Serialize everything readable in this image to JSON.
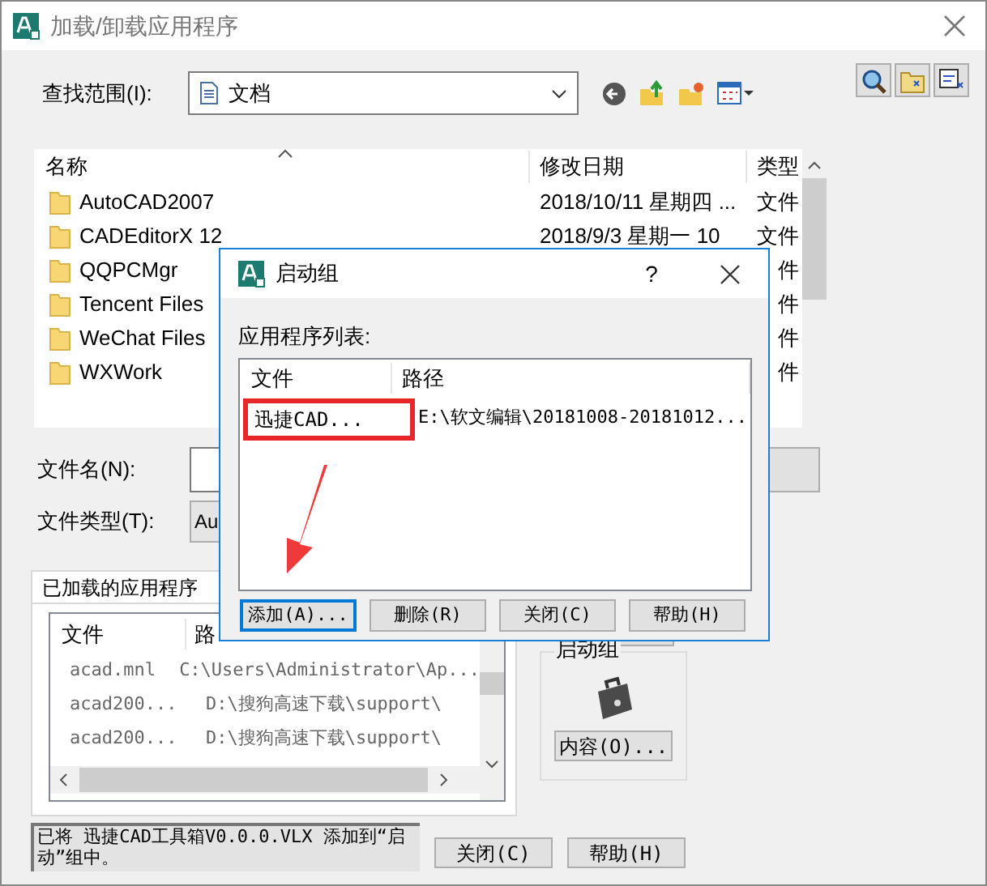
{
  "window": {
    "title": "加载/卸载应用程序"
  },
  "look_in": {
    "label": "查找范围(I):",
    "value": "文档"
  },
  "file_list": {
    "columns": [
      "名称",
      "修改日期",
      "类型"
    ],
    "rows": [
      {
        "name": "AutoCAD2007",
        "date": "2018/10/11 星期四 ...",
        "type": "文件"
      },
      {
        "name": "CADEditorX 12",
        "date": "2018/9/3 星期一 10",
        "type": "文件"
      },
      {
        "name": "QQPCMgr",
        "date": "",
        "type": "件"
      },
      {
        "name": "Tencent Files",
        "date": "",
        "type": "件"
      },
      {
        "name": "WeChat Files",
        "date": "",
        "type": "件"
      },
      {
        "name": "WXWork",
        "date": "",
        "type": "件"
      }
    ]
  },
  "file_name": {
    "label": "文件名(N):"
  },
  "file_type": {
    "label": "文件类型(T):",
    "value": "Au"
  },
  "loaded_tab": {
    "label": "已加载的应用程序",
    "columns": [
      "文件",
      "路"
    ],
    "rows": [
      {
        "file": "acad.mnl",
        "path": "C:\\Users\\Administrator\\Ap..."
      },
      {
        "file": "acad200...",
        "path": "D:\\搜狗高速下载\\support\\"
      },
      {
        "file": "acad200...",
        "path": "D:\\搜狗高速下载\\support\\"
      }
    ]
  },
  "startup_group": {
    "title": "启动组",
    "button": "内容(O)..."
  },
  "status": "已将 迅捷CAD工具箱V0.0.0.VLX 添加到“启动”组中。",
  "buttons": [
    "关闭(C)",
    "帮助(H)"
  ],
  "dialog": {
    "title": "启动组",
    "help": "?",
    "list_label": "应用程序列表:",
    "columns": [
      "文件",
      "路径"
    ],
    "rows": [
      {
        "file": "迅捷CAD...",
        "path": "E:\\软文编辑\\20181008-20181012..."
      }
    ],
    "buttons": [
      {
        "label": "添加(A)...",
        "selected": true
      },
      {
        "label": "删除(R)",
        "selected": false
      },
      {
        "label": "关闭(C)",
        "selected": false
      },
      {
        "label": "帮助(H)",
        "selected": false
      }
    ]
  }
}
